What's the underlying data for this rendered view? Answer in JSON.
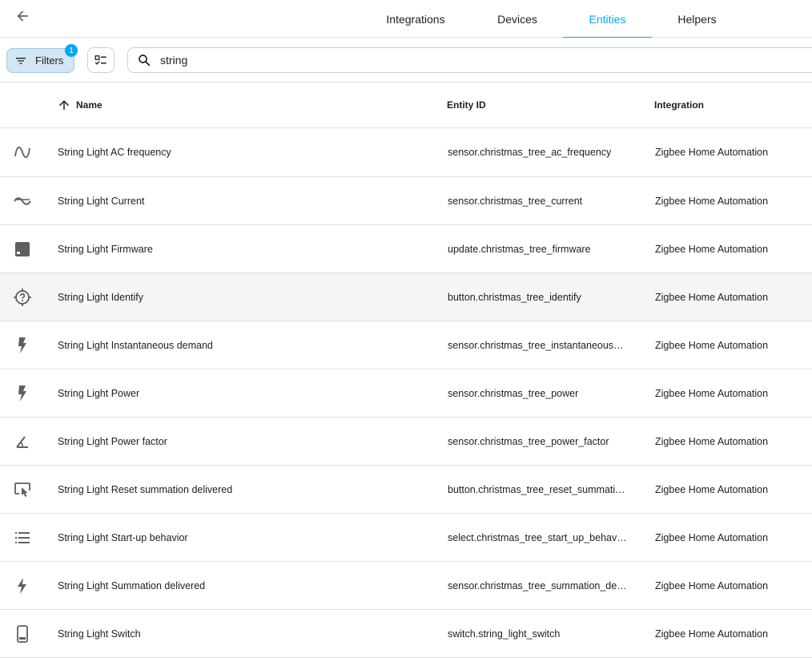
{
  "tabs": [
    {
      "label": "Integrations",
      "active": false
    },
    {
      "label": "Devices",
      "active": false
    },
    {
      "label": "Entities",
      "active": true
    },
    {
      "label": "Helpers",
      "active": false
    }
  ],
  "toolbar": {
    "filter_label": "Filters",
    "filter_count": "1",
    "search_value": "string",
    "search_icon": "search-icon",
    "select_icon": "select-mode-icon"
  },
  "table": {
    "columns": {
      "name": "Name",
      "entity_id": "Entity ID",
      "integration": "Integration"
    },
    "sort": "ascending",
    "rows": [
      {
        "icon": "sine-wave-icon",
        "name": "String Light AC frequency",
        "entity_id": "sensor.christmas_tree_ac_frequency",
        "integration": "Zigbee Home Automation"
      },
      {
        "icon": "current-ac-icon",
        "name": "String Light Current",
        "entity_id": "sensor.christmas_tree_current",
        "integration": "Zigbee Home Automation"
      },
      {
        "icon": "package-up-icon",
        "name": "String Light Firmware",
        "entity_id": "update.christmas_tree_firmware",
        "integration": "Zigbee Home Automation"
      },
      {
        "icon": "crosshairs-question-icon",
        "name": "String Light Identify",
        "entity_id": "button.christmas_tree_identify",
        "integration": "Zigbee Home Automation"
      },
      {
        "icon": "flash-icon",
        "name": "String Light Instantaneous demand",
        "entity_id": "sensor.christmas_tree_instantaneous…",
        "integration": "Zigbee Home Automation"
      },
      {
        "icon": "flash-icon",
        "name": "String Light Power",
        "entity_id": "sensor.christmas_tree_power",
        "integration": "Zigbee Home Automation"
      },
      {
        "icon": "angle-acute-icon",
        "name": "String Light Power factor",
        "entity_id": "sensor.christmas_tree_power_factor",
        "integration": "Zigbee Home Automation"
      },
      {
        "icon": "gesture-tap-button-icon",
        "name": "String Light Reset summation delivered",
        "entity_id": "button.christmas_tree_reset_summati…",
        "integration": "Zigbee Home Automation"
      },
      {
        "icon": "format-list-bulleted-icon",
        "name": "String Light Start-up behavior",
        "entity_id": "select.christmas_tree_start_up_behav…",
        "integration": "Zigbee Home Automation"
      },
      {
        "icon": "lightning-bolt-icon",
        "name": "String Light Summation delivered",
        "entity_id": "sensor.christmas_tree_summation_de…",
        "integration": "Zigbee Home Automation"
      },
      {
        "icon": "cellphone-icon",
        "name": "String Light Switch",
        "entity_id": "switch.string_light_switch",
        "integration": "Zigbee Home Automation"
      }
    ]
  },
  "colors": {
    "accent": "#03a9f4",
    "icon": "#5f5f5f",
    "filter_bg": "#d3e6f3"
  }
}
